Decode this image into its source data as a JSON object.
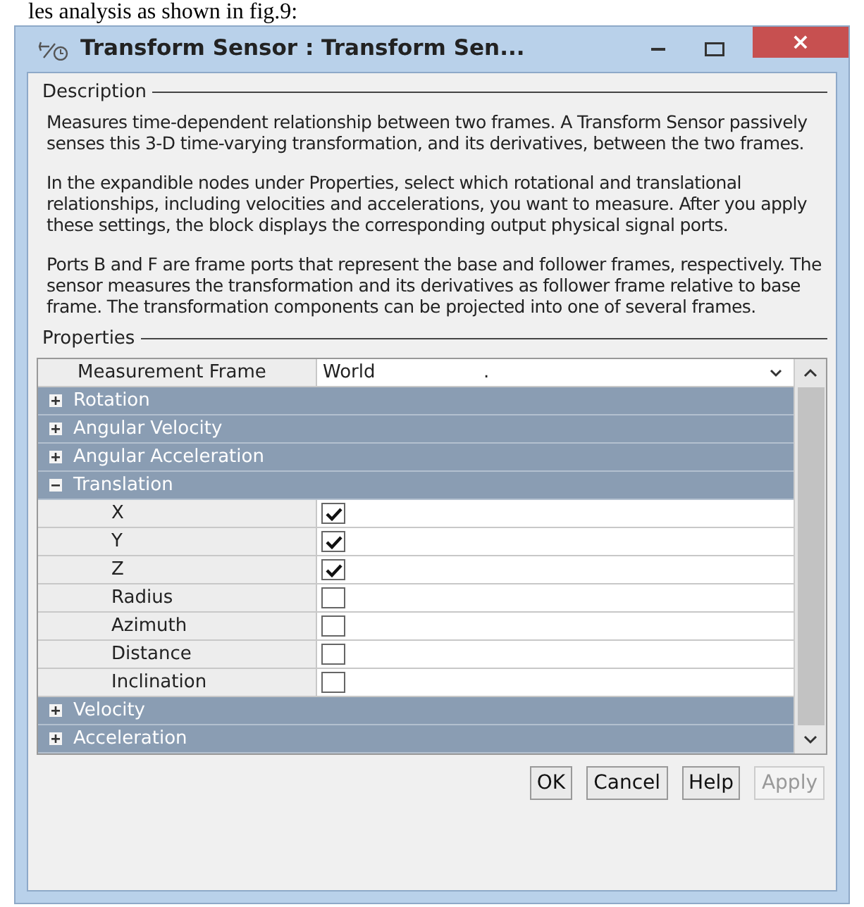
{
  "caption": "les analysis as shown in fig.9:",
  "window": {
    "title": "Transform Sensor : Transform Sen...",
    "close": "×"
  },
  "description": {
    "label": "Description",
    "paragraphs": [
      "Measures time-dependent relationship between two frames. A Transform Sensor passively senses this 3-D time-varying transformation, and its derivatives, between the two frames.",
      "In the expandible nodes under Properties, select which rotational and translational relationships, including velocities and accelerations, you want to measure. After you apply these settings, the block displays the corresponding output physical signal ports.",
      "Ports B and F are frame ports that represent the base and follower frames, respectively. The sensor measures the transformation and its derivatives as follower frame relative to base frame. The transformation components can be projected into one of several frames."
    ]
  },
  "properties": {
    "label": "Properties",
    "rows": [
      {
        "kind": "dropdown",
        "label": "Measurement Frame",
        "value": "World",
        "mark": "."
      },
      {
        "kind": "group",
        "label": "Rotation",
        "expanded": false
      },
      {
        "kind": "group",
        "label": "Angular Velocity",
        "expanded": false
      },
      {
        "kind": "group",
        "label": "Angular Acceleration",
        "expanded": false
      },
      {
        "kind": "group",
        "label": "Translation",
        "expanded": true
      },
      {
        "kind": "check",
        "label": "X",
        "checked": true
      },
      {
        "kind": "check",
        "label": "Y",
        "checked": true
      },
      {
        "kind": "check",
        "label": "Z",
        "checked": true
      },
      {
        "kind": "check",
        "label": "Radius",
        "checked": false
      },
      {
        "kind": "check",
        "label": "Azimuth",
        "checked": false
      },
      {
        "kind": "check",
        "label": "Distance",
        "checked": false
      },
      {
        "kind": "check",
        "label": "Inclination",
        "checked": false
      },
      {
        "kind": "group",
        "label": "Velocity",
        "expanded": false
      },
      {
        "kind": "group",
        "label": "Acceleration",
        "expanded": false
      }
    ]
  },
  "buttons": [
    {
      "label": "OK",
      "disabled": false
    },
    {
      "label": "Cancel",
      "disabled": false
    },
    {
      "label": "Help",
      "disabled": false
    },
    {
      "label": "Apply",
      "disabled": true
    }
  ]
}
